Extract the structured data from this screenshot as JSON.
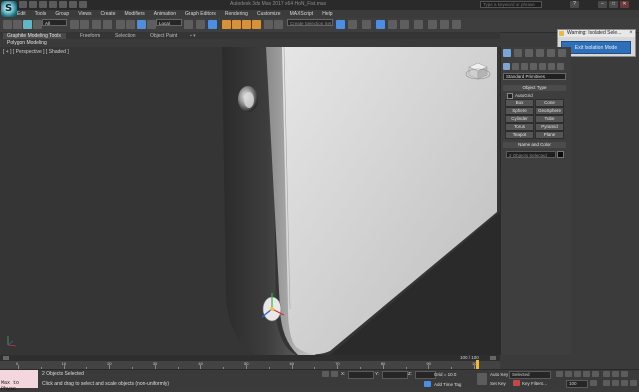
{
  "window": {
    "title": "Autodesk 3ds Max 2017 x64    HoN_Fist.max",
    "search_placeholder": "Type a keyword or phrase",
    "controls": [
      "–",
      "□",
      "✕"
    ]
  },
  "menu": {
    "items": [
      "Edit",
      "Tools",
      "Group",
      "Views",
      "Create",
      "Modifiers",
      "Animation",
      "Graph Editors",
      "Rendering",
      "Customize",
      "MAXScript",
      "Help"
    ]
  },
  "toolbar": {
    "selection_filter": "All",
    "reference_coord": "Local",
    "named_selection": "Create Selection Set"
  },
  "ribbon": {
    "active_tab": "Graphite Modeling Tools",
    "tabs": [
      "Freeform",
      "Selection",
      "Object Paint"
    ],
    "panel": "Polygon Modeling"
  },
  "viewport": {
    "label": "[ + ] [ Perspective ] [ Shaded ]",
    "gizmo": "viewcube-icon",
    "axis": "axis-tripod-icon"
  },
  "command_panel": {
    "active_tab": "create",
    "tabs": [
      "create",
      "modify",
      "hierarchy",
      "motion",
      "display",
      "utilities"
    ],
    "categories": [
      "geometry",
      "shapes",
      "lights",
      "cameras",
      "helpers",
      "space-warps",
      "systems"
    ],
    "primitive_type": "Standard Primitives",
    "object_type_title": "Object Type",
    "autogrid_label": "AutoGrid",
    "buttons": [
      "Box",
      "Cone",
      "Sphere",
      "GeoSphere",
      "Cylinder",
      "Tube",
      "Torus",
      "Pyramid",
      "Teapot",
      "Plane"
    ],
    "name_color_title": "Name and Color",
    "name_value": "2 Objects Selected",
    "color": "#0c0c0c"
  },
  "warning": {
    "title": "Warning: Isolated Sele...",
    "button": "Exit Isolation Mode"
  },
  "timeline": {
    "frame_label": "100 / 100",
    "ticks": [
      0,
      10,
      20,
      30,
      40,
      50,
      60,
      70,
      80,
      90,
      100
    ]
  },
  "status": {
    "maxscript": "Max to Physc.",
    "line1": "2 Objects Selected",
    "line2": "Click and drag to select and scale objects (non-uniformly)",
    "x_label": "X:",
    "y_label": "Y:",
    "z_label": "Z:",
    "grid": "Grid = 10.0",
    "add_time_tag": "Add Time Tag",
    "auto_key": "Auto Key",
    "set_key": "Set Key",
    "key_filters": "Key Filters...",
    "selected_value": "Selected",
    "frame_value": "100"
  },
  "colors": {
    "accent_blue": "#2f6fb8",
    "timeline_marker": "#e8b84a"
  }
}
